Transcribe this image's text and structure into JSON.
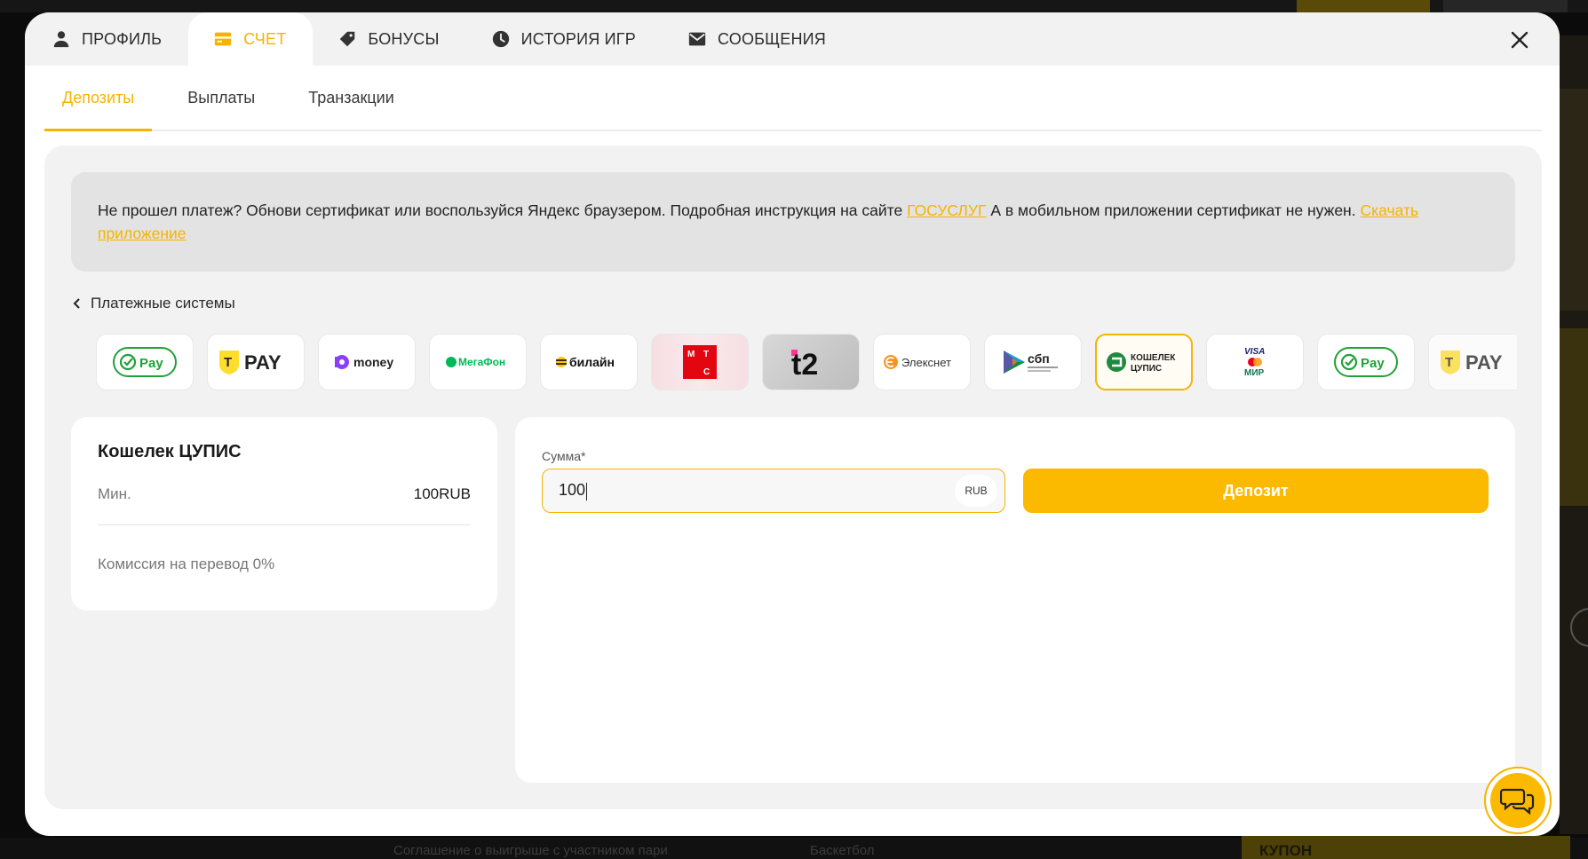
{
  "background": {
    "footer_link_1": "Соглашение о выигрыше с участником пари",
    "footer_link_2": "Баскетбол",
    "coupon_label": "КУПОН"
  },
  "tabs": [
    {
      "label": "ПРОФИЛЬ",
      "icon": "user-icon",
      "active": false
    },
    {
      "label": "СЧЕТ",
      "icon": "card-icon",
      "active": true
    },
    {
      "label": "БОНУСЫ",
      "icon": "tag-icon",
      "active": false
    },
    {
      "label": "ИСТОРИЯ ИГР",
      "icon": "clock-icon",
      "active": false
    },
    {
      "label": "СООБЩЕНИЯ",
      "icon": "envelope-icon",
      "active": false
    }
  ],
  "subtabs": [
    {
      "label": "Депозиты",
      "active": true
    },
    {
      "label": "Выплаты",
      "active": false
    },
    {
      "label": "Транзакции",
      "active": false
    }
  ],
  "notice": {
    "text_1": "Не прошел платеж? Обнови сертификат или воспользуйся Яндекс браузером. Подробная инструкция на сайте ",
    "link_1": "ГОСУСЛУГ",
    "text_2": " А в мобильном приложении сертификат не нужен. ",
    "link_2": "Скачать приложение"
  },
  "payment_systems": {
    "title": "Платежные системы",
    "items": [
      {
        "name": "Pay",
        "logo": "sber-pay-logo"
      },
      {
        "name": "PAY",
        "logo": "t-pay-logo"
      },
      {
        "name": "money",
        "logo": "yoomoney-logo"
      },
      {
        "name": "МегаФон",
        "logo": "megafon-logo"
      },
      {
        "name": "билайн",
        "logo": "beeline-logo"
      },
      {
        "name": "МТС",
        "logo": "mts-logo"
      },
      {
        "name": "t2",
        "logo": "t2-logo"
      },
      {
        "name": "Элекснет",
        "logo": "elecsnet-logo"
      },
      {
        "name": "сбп",
        "logo": "sbp-logo"
      },
      {
        "name": "КОШЕЛЕК ЦУПИС",
        "logo": "cupis-logo",
        "selected": true
      },
      {
        "name": "VISA МИР",
        "logo": "visa-mir-logo"
      },
      {
        "name": "Pay",
        "logo": "sber-pay-logo"
      },
      {
        "name": "PAY",
        "logo": "t-pay-logo"
      }
    ]
  },
  "method_info": {
    "title": "Кошелек ЦУПИС",
    "min_label": "Мин.",
    "min_value": "100RUB",
    "fee_text": "Комиссия на перевод 0%"
  },
  "form": {
    "amount_label": "Сумма*",
    "amount_value": "100",
    "currency": "RUB",
    "submit_label": "Депозит"
  },
  "colors": {
    "accent": "#f5b400",
    "button": "#fbb900"
  }
}
